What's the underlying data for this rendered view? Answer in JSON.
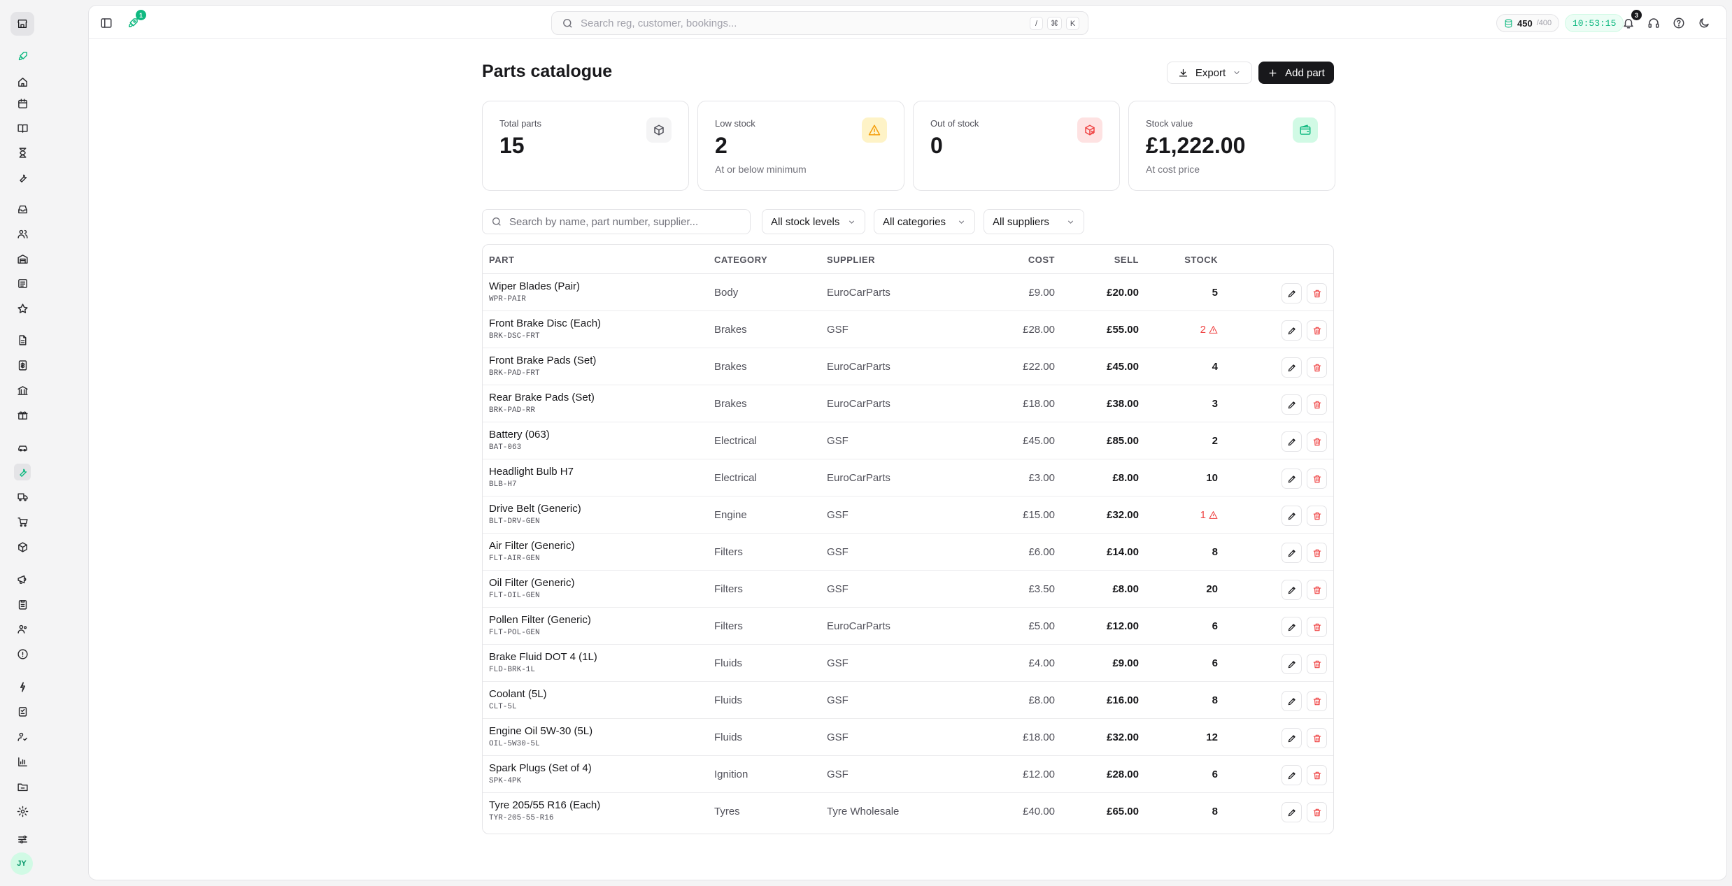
{
  "topbar": {
    "notif_badge_rocket": "1",
    "search_placeholder": "Search reg, customer, bookings...",
    "shortcut_keys": [
      "/",
      "⌘",
      "K"
    ],
    "credits_value": "450",
    "credits_max": "/400",
    "clock": "10:53:15",
    "bell_badge": "3"
  },
  "page": {
    "title": "Parts catalogue",
    "export_label": "Export",
    "add_label": "Add part"
  },
  "stats": [
    {
      "label": "Total parts",
      "value": "15",
      "sub": "",
      "icon": "package-icon",
      "color": "#52525b",
      "bg": "#f4f4f5"
    },
    {
      "label": "Low stock",
      "value": "2",
      "sub": "At or below minimum",
      "icon": "warning-icon",
      "color": "#f59e0b",
      "bg": "#fef3c7"
    },
    {
      "label": "Out of stock",
      "value": "0",
      "sub": "",
      "icon": "package-x-icon",
      "color": "#ef4444",
      "bg": "#fee2e2"
    },
    {
      "label": "Stock value",
      "value": "£1,222.00",
      "sub": "At cost price",
      "icon": "wallet-icon",
      "color": "#10b981",
      "bg": "#d1fae5"
    }
  ],
  "filters": {
    "search_placeholder": "Search by name, part number, supplier...",
    "stock": "All stock levels",
    "category": "All categories",
    "supplier": "All suppliers"
  },
  "table": {
    "headers": {
      "part": "PART",
      "category": "CATEGORY",
      "supplier": "SUPPLIER",
      "cost": "COST",
      "sell": "SELL",
      "stock": "STOCK"
    },
    "rows": [
      {
        "name": "Wiper Blades (Pair)",
        "code": "WPR-PAIR",
        "category": "Body",
        "supplier": "EuroCarParts",
        "cost": "£9.00",
        "sell": "£20.00",
        "stock": "5",
        "low": false
      },
      {
        "name": "Front Brake Disc (Each)",
        "code": "BRK-DSC-FRT",
        "category": "Brakes",
        "supplier": "GSF",
        "cost": "£28.00",
        "sell": "£55.00",
        "stock": "2",
        "low": true
      },
      {
        "name": "Front Brake Pads (Set)",
        "code": "BRK-PAD-FRT",
        "category": "Brakes",
        "supplier": "EuroCarParts",
        "cost": "£22.00",
        "sell": "£45.00",
        "stock": "4",
        "low": false
      },
      {
        "name": "Rear Brake Pads (Set)",
        "code": "BRK-PAD-RR",
        "category": "Brakes",
        "supplier": "EuroCarParts",
        "cost": "£18.00",
        "sell": "£38.00",
        "stock": "3",
        "low": false
      },
      {
        "name": "Battery (063)",
        "code": "BAT-063",
        "category": "Electrical",
        "supplier": "GSF",
        "cost": "£45.00",
        "sell": "£85.00",
        "stock": "2",
        "low": false
      },
      {
        "name": "Headlight Bulb H7",
        "code": "BLB-H7",
        "category": "Electrical",
        "supplier": "EuroCarParts",
        "cost": "£3.00",
        "sell": "£8.00",
        "stock": "10",
        "low": false
      },
      {
        "name": "Drive Belt (Generic)",
        "code": "BLT-DRV-GEN",
        "category": "Engine",
        "supplier": "GSF",
        "cost": "£15.00",
        "sell": "£32.00",
        "stock": "1",
        "low": true
      },
      {
        "name": "Air Filter (Generic)",
        "code": "FLT-AIR-GEN",
        "category": "Filters",
        "supplier": "GSF",
        "cost": "£6.00",
        "sell": "£14.00",
        "stock": "8",
        "low": false
      },
      {
        "name": "Oil Filter (Generic)",
        "code": "FLT-OIL-GEN",
        "category": "Filters",
        "supplier": "GSF",
        "cost": "£3.50",
        "sell": "£8.00",
        "stock": "20",
        "low": false
      },
      {
        "name": "Pollen Filter (Generic)",
        "code": "FLT-POL-GEN",
        "category": "Filters",
        "supplier": "EuroCarParts",
        "cost": "£5.00",
        "sell": "£12.00",
        "stock": "6",
        "low": false
      },
      {
        "name": "Brake Fluid DOT 4 (1L)",
        "code": "FLD-BRK-1L",
        "category": "Fluids",
        "supplier": "GSF",
        "cost": "£4.00",
        "sell": "£9.00",
        "stock": "6",
        "low": false
      },
      {
        "name": "Coolant (5L)",
        "code": "CLT-5L",
        "category": "Fluids",
        "supplier": "GSF",
        "cost": "£8.00",
        "sell": "£16.00",
        "stock": "8",
        "low": false
      },
      {
        "name": "Engine Oil 5W-30 (5L)",
        "code": "OIL-5W30-5L",
        "category": "Fluids",
        "supplier": "GSF",
        "cost": "£18.00",
        "sell": "£32.00",
        "stock": "12",
        "low": false
      },
      {
        "name": "Spark Plugs (Set of 4)",
        "code": "SPK-4PK",
        "category": "Ignition",
        "supplier": "GSF",
        "cost": "£12.00",
        "sell": "£28.00",
        "stock": "6",
        "low": false
      },
      {
        "name": "Tyre 205/55 R16 (Each)",
        "code": "TYR-205-55-R16",
        "category": "Tyres",
        "supplier": "Tyre Wholesale",
        "cost": "£40.00",
        "sell": "£65.00",
        "stock": "8",
        "low": false
      }
    ]
  },
  "sidebar": {
    "avatar": "JY",
    "icons": [
      "rocket-icon",
      "home-icon",
      "calendar-icon",
      "book-icon",
      "hourglass-icon",
      "wrench-icon",
      "inbox-icon",
      "users-icon",
      "warehouse-icon",
      "document-icon",
      "star-icon",
      "file-icon",
      "invoice-icon",
      "bank-icon",
      "gift-icon",
      "car-icon",
      "wrench-active-icon",
      "truck-icon",
      "cart-icon",
      "package-icon",
      "megaphone-icon",
      "clipboard-icon",
      "team-icon",
      "info-icon",
      "integrations-icon",
      "checklist-icon",
      "user-check-icon",
      "chart-icon",
      "folder-icon",
      "settings-icon",
      "sliders-icon"
    ]
  }
}
